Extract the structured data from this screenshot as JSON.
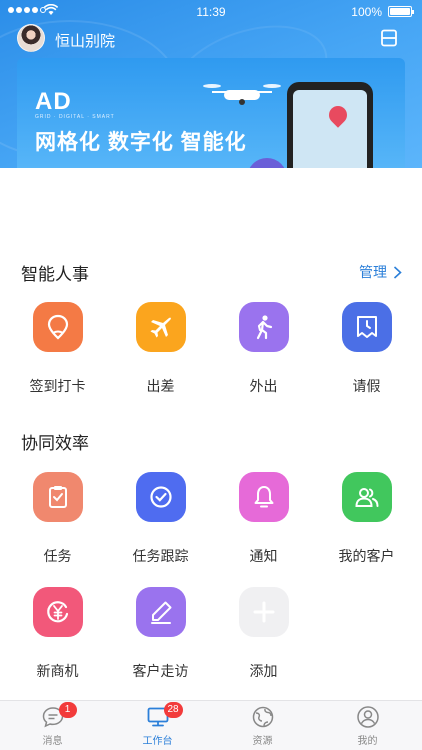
{
  "status_bar": {
    "time": "11:39",
    "battery": "100%"
  },
  "header": {
    "username": "恒山别院"
  },
  "banner": {
    "logo": "AD",
    "logo_sub": "GRID · DIGITAL · SMART",
    "slogan": "网格化 数字化 智能化",
    "dot_count": 3,
    "active_dot": 0
  },
  "sections": [
    {
      "title": "智能人事",
      "manage_label": "管理",
      "items": [
        {
          "label": "签到打卡",
          "icon": "location-pin-icon",
          "color": "#f47a45"
        },
        {
          "label": "出差",
          "icon": "airplane-icon",
          "color": "#fba51e"
        },
        {
          "label": "外出",
          "icon": "walking-person-icon",
          "color": "#9a73ee"
        },
        {
          "label": "请假",
          "icon": "leave-clock-icon",
          "color": "#4b6fe6"
        }
      ]
    },
    {
      "title": "协同效率",
      "items": [
        {
          "label": "任务",
          "icon": "clipboard-check-icon",
          "color": "#f0886e"
        },
        {
          "label": "任务跟踪",
          "icon": "check-circle-icon",
          "color": "#4f6cf0"
        },
        {
          "label": "通知",
          "icon": "bell-icon",
          "color": "#e66ad8"
        },
        {
          "label": "我的客户",
          "icon": "customers-icon",
          "color": "#41c75d"
        },
        {
          "label": "新商机",
          "icon": "yuan-refresh-icon",
          "color": "#f2587a"
        },
        {
          "label": "客户走访",
          "icon": "pen-icon",
          "color": "#9a73ee"
        },
        {
          "label": "添加",
          "icon": "plus-icon",
          "color": "#f0f0f2"
        }
      ]
    }
  ],
  "tabbar": [
    {
      "label": "消息",
      "icon": "message-icon",
      "badge": "1"
    },
    {
      "label": "工作台",
      "icon": "workbench-icon",
      "badge": "28",
      "active": true
    },
    {
      "label": "资源",
      "icon": "globe-icon",
      "badge": ""
    },
    {
      "label": "我的",
      "icon": "profile-icon",
      "badge": ""
    }
  ],
  "colors": {
    "accent": "#2b7fd9",
    "header": "#2f94ee"
  }
}
